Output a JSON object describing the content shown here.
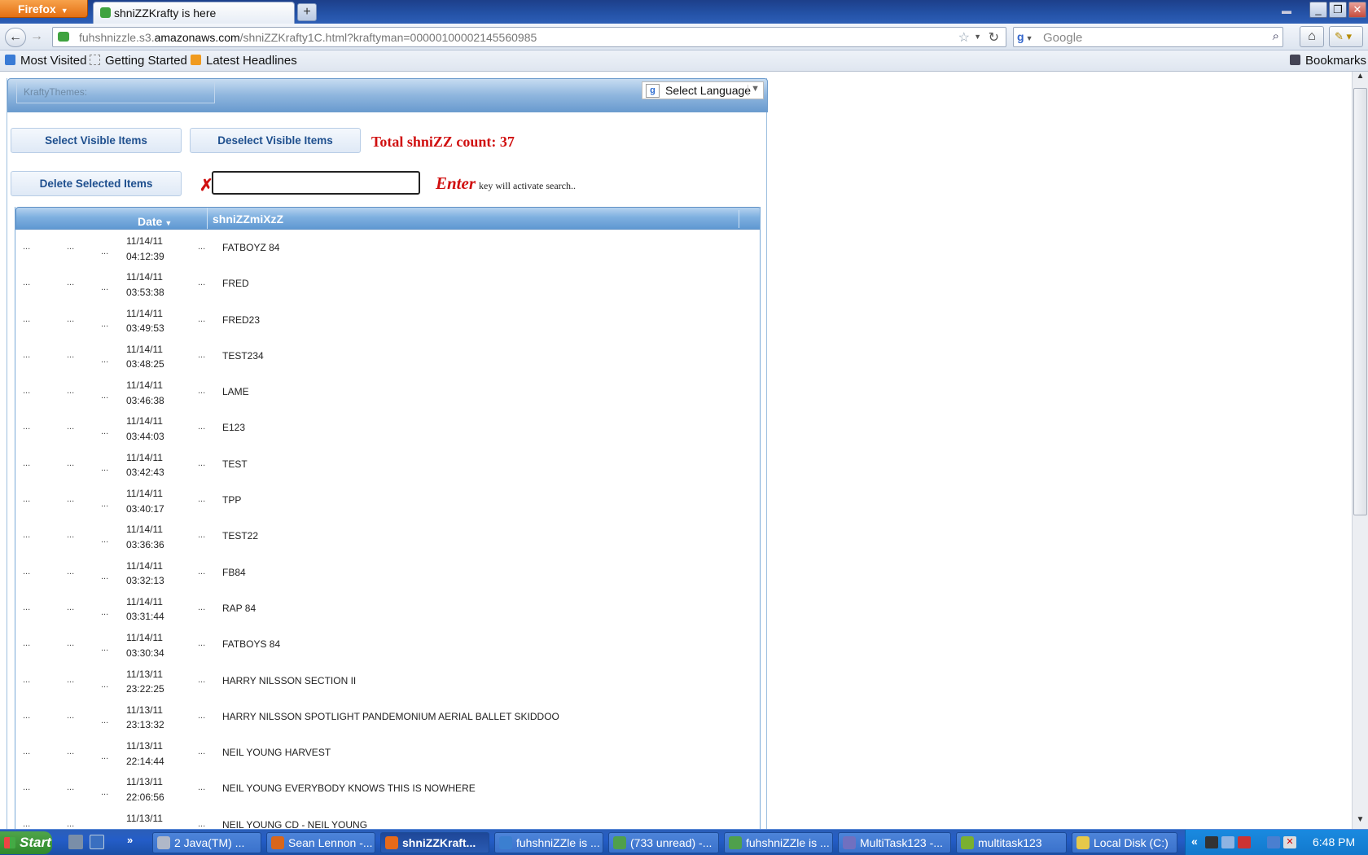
{
  "browser": {
    "app_button": "Firefox",
    "tab_title": "shniZZKrafty is here",
    "new_tab": "+",
    "url_host_pre": "fuhshnizzle.s3.",
    "url_host_main": "amazonaws.com",
    "url_path": "/shniZZKrafty1C.html?kraftyman=0000010000214556098​5",
    "search_placeholder": "Google",
    "bookmarks": [
      "Most Visited",
      "Getting Started",
      "Latest Headlines"
    ],
    "bookmarks_menu": "Bookmarks"
  },
  "app": {
    "themes_label": "KraftyThemes:",
    "language_label": "Select Language",
    "select_visible": "Select Visible Items",
    "deselect_visible": "Deselect Visible Items",
    "delete_selected": "Delete Selected Items",
    "total_label": "Total shniZZ count: 37",
    "search_value": "",
    "hint_enter": "Enter",
    "hint_rest": "key will activate search..",
    "columns": {
      "date": "Date",
      "name": "shniZZmiXzZ"
    },
    "rows": [
      {
        "date": "11/14/11",
        "time": "04:12:39",
        "name": "FATBOYZ 84"
      },
      {
        "date": "11/14/11",
        "time": "03:53:38",
        "name": "FRED"
      },
      {
        "date": "11/14/11",
        "time": "03:49:53",
        "name": "FRED23"
      },
      {
        "date": "11/14/11",
        "time": "03:48:25",
        "name": "TEST234"
      },
      {
        "date": "11/14/11",
        "time": "03:46:38",
        "name": "LAME"
      },
      {
        "date": "11/14/11",
        "time": "03:44:03",
        "name": "E123"
      },
      {
        "date": "11/14/11",
        "time": "03:42:43",
        "name": "TEST"
      },
      {
        "date": "11/14/11",
        "time": "03:40:17",
        "name": "TPP"
      },
      {
        "date": "11/14/11",
        "time": "03:36:36",
        "name": "TEST22"
      },
      {
        "date": "11/14/11",
        "time": "03:32:13",
        "name": "FB84"
      },
      {
        "date": "11/14/11",
        "time": "03:31:44",
        "name": "RAP 84"
      },
      {
        "date": "11/14/11",
        "time": "03:30:34",
        "name": "FATBOYS 84"
      },
      {
        "date": "11/13/11",
        "time": "23:22:25",
        "name": "HARRY NILSSON SECTION II"
      },
      {
        "date": "11/13/11",
        "time": "23:13:32",
        "name": "HARRY NILSSON SPOTLIGHT PANDEMONIUM AERIAL BALLET SKIDDOO"
      },
      {
        "date": "11/13/11",
        "time": "22:14:44",
        "name": "NEIL YOUNG HARVEST"
      },
      {
        "date": "11/13/11",
        "time": "22:06:56",
        "name": "NEIL YOUNG EVERYBODY KNOWS THIS IS NOWHERE"
      },
      {
        "date": "11/13/11",
        "time": "",
        "name": "NEIL YOUNG CD - NEIL YOUNG"
      }
    ],
    "ellipsis": "..."
  },
  "taskbar": {
    "start": "Start",
    "items": [
      "2 Java(TM) ...",
      "Sean Lennon -...",
      "shniZZKraft...",
      "fuhshniZZle is ...",
      "(733 unread) -...",
      "fuhshniZZle is ...",
      "MultiTask123 -...",
      "multitask123",
      "Local Disk (C:)"
    ],
    "tray_chevron": "«",
    "clock": "6:48 PM"
  },
  "colors": {
    "accent_red": "#d01010",
    "header_blue": "#6a9bcf",
    "button_text": "#1e4f8e"
  }
}
